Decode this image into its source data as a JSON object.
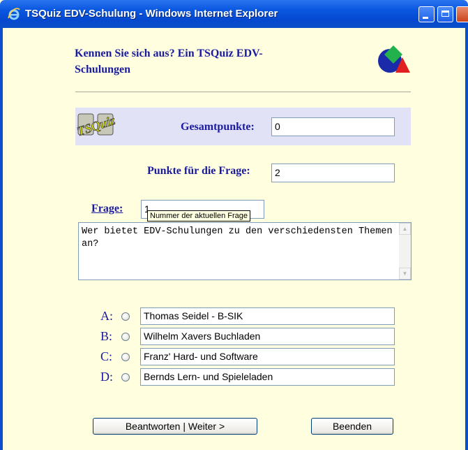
{
  "window": {
    "title": "TSQuiz EDV-Schulung - Windows Internet Explorer"
  },
  "page": {
    "heading": "Kennen Sie sich aus? Ein TSQuiz EDV-Schulungen",
    "logo_text": "TSQuiz"
  },
  "score": {
    "total_label": "Gesamtpunkte:",
    "total_value": "0",
    "question_points_label": "Punkte für die Frage:",
    "question_points_value": "2"
  },
  "question": {
    "number_label": "Frage:",
    "number_value": "1",
    "tooltip": "Nummer der aktuellen Frage",
    "text": "Wer bietet EDV-Schulungen zu den verschiedensten Themen an?"
  },
  "answers": [
    {
      "letter": "A:",
      "text": "Thomas Seidel - B-SIK"
    },
    {
      "letter": "B:",
      "text": "Wilhelm Xavers Buchladen"
    },
    {
      "letter": "C:",
      "text": "Franz' Hard- und Software"
    },
    {
      "letter": "D:",
      "text": "Bernds Lern- und Spieleladen"
    }
  ],
  "buttons": {
    "answer_next": "Beantworten | Weiter >",
    "quit": "Beenden"
  },
  "colors": {
    "accent_text": "#1a1aa0",
    "page_background": "#ffffe0",
    "score_band": "#e2e2f6"
  }
}
